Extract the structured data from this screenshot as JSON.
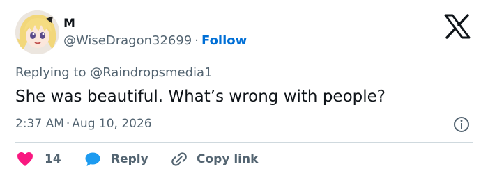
{
  "author": {
    "name": "M",
    "handle": "@WiseDragon32699",
    "separator": "·",
    "follow_label": "Follow"
  },
  "reply_context": "Replying to @Raindropsmedia1",
  "tweet_text": "She was beautiful. What’s wrong with people?",
  "timestamp": {
    "time": "2:37 AM",
    "separator": "·",
    "date": "Aug 10, 2026"
  },
  "actions": {
    "like_count": "14",
    "reply_label": "Reply",
    "copy_link_label": "Copy link"
  },
  "icons": {
    "logo": "x-logo-icon",
    "info": "info-icon",
    "like": "heart-icon",
    "reply": "speech-bubble-icon",
    "copy": "link-icon"
  },
  "colors": {
    "text": "#0f1419",
    "secondary": "#536471",
    "follow": "#006fd6",
    "like": "#f91880",
    "reply": "#1d9bf0",
    "divider": "#cfd9de"
  }
}
